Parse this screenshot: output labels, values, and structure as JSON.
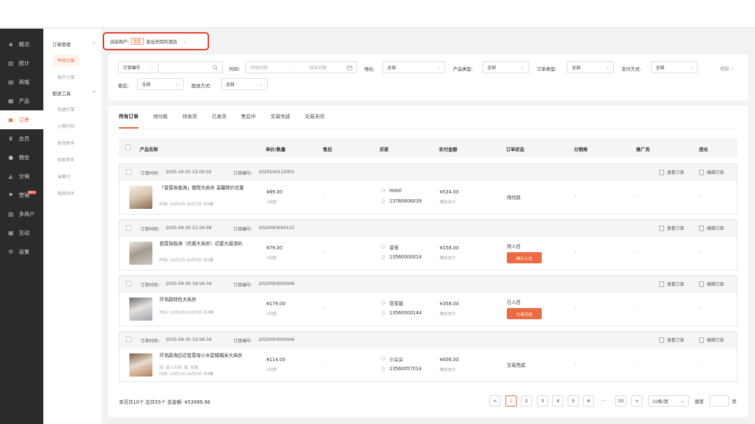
{
  "nav1": [
    {
      "label": "概况",
      "icon": "layers-icon",
      "glyph": "◈"
    },
    {
      "label": "统计",
      "icon": "chart-icon",
      "glyph": "▥"
    },
    {
      "label": "商城",
      "icon": "store-icon",
      "glyph": "▤"
    },
    {
      "label": "产品",
      "icon": "grid-icon",
      "glyph": "▦"
    },
    {
      "label": "订单",
      "icon": "order-icon",
      "glyph": "▣",
      "active": true
    },
    {
      "label": "会员",
      "icon": "crown-icon",
      "glyph": "♛"
    },
    {
      "label": "微信",
      "icon": "wechat-icon",
      "glyph": "●"
    },
    {
      "label": "分销",
      "icon": "distribution-icon",
      "glyph": "◭"
    },
    {
      "label": "营销",
      "icon": "flag-icon",
      "glyph": "⚑",
      "badge": "NEW"
    },
    {
      "label": "多商户",
      "icon": "merchants-icon",
      "glyph": "▧"
    },
    {
      "label": "互动",
      "icon": "interact-icon",
      "glyph": "▦"
    },
    {
      "label": "设置",
      "icon": "gear-icon",
      "glyph": "⚙"
    }
  ],
  "nav2": {
    "group1": "订单管理",
    "group1_items": [
      "平台订单",
      "商户订单"
    ],
    "group2": "配送工具",
    "group2_items": [
      "快递打单",
      "小票打印",
      "发货助手",
      "商家助手",
      "当面付",
      "电商ERP"
    ]
  },
  "merchant": {
    "label": "当前商户:",
    "tag": "直营",
    "name": "浪出天际的酒店"
  },
  "filters": {
    "order_no_select": "订单编号",
    "time_label": "时间:",
    "start_date": "开始日期",
    "date_sep": "-",
    "end_date": "结束日期",
    "address_label": "地址:",
    "address_value": "全部",
    "product_type_label": "产品类型:",
    "product_type_value": "全部",
    "order_type_label": "订单类型:",
    "order_type_value": "全部",
    "pay_method_label": "支付方式:",
    "pay_method_value": "全部",
    "collapse": "收起",
    "aftersale_label": "售后:",
    "aftersale_value": "全部",
    "delivery_label": "配送方式:",
    "delivery_value": "全部"
  },
  "tabs": [
    "所有订单",
    "待付款",
    "待发货",
    "已发货",
    "售后中",
    "交易完成",
    "交易关闭"
  ],
  "table_headers": [
    "产品名称",
    "单价/数量",
    "售后",
    "买家",
    "实付金额",
    "订单状态",
    "分销商",
    "推广员",
    "团长"
  ],
  "orders": [
    {
      "time_label": "订单时间:",
      "time": "2020-10-01  12:00:02",
      "no_label": "订单编号:",
      "no": "2020100112001",
      "view": "查看订单",
      "edit": "编辑订单",
      "name": "「曾厝垵临海」南院大床房 温馨特价优惠",
      "meta1": "时间: 10月1日-10月7日  共6晚",
      "meta2": "",
      "price": "¥89.00",
      "qty": "1间房",
      "aftersale": "-",
      "buyer": "Hotel",
      "phone": "13760606039",
      "amount": "¥534.00",
      "pay": "微信支付",
      "status": "待付款",
      "action": "",
      "distributor": "-",
      "promoter": "-",
      "leader": "-"
    },
    {
      "time_label": "订单时间:",
      "time": "2020-09-30  21:26:58",
      "no_label": "订单编号:",
      "no": "2020093000122",
      "view": "查看订单",
      "edit": "编辑订单",
      "name": "曾厝垵临海（优雅大床房）近厦大鼓浪屿",
      "meta1": "时间: 10月1日-10月3日  共2晚",
      "meta2": "",
      "price": "¥79.00",
      "qty": "1间房",
      "aftersale": "-",
      "buyer": "梁哥",
      "phone": "13560000014",
      "amount": "¥158.00",
      "pay": "微信支付",
      "status": "待入住",
      "action": "确认入住",
      "distributor": "-",
      "promoter": "-",
      "leader": "-"
    },
    {
      "time_label": "订单时间:",
      "time": "2020-09-30  16:56:34",
      "no_label": "订单编号:",
      "no": "2020093000046",
      "view": "查看订单",
      "edit": "编辑订单",
      "name": "环岛路特色大床房",
      "meta1": "时间: 10月1日-10月3日  共2晚",
      "meta2": "",
      "price": "¥179.00",
      "qty": "1间房",
      "aftersale": "-",
      "buyer": "菲菲姐",
      "phone": "13560000144",
      "amount": "¥358.00",
      "pay": "微信支付",
      "status": "已入住",
      "action": "交易完成",
      "distributor": "-",
      "promoter": "-",
      "leader": "-"
    },
    {
      "time_label": "订单时间:",
      "time": "2020-09-30  10:56:34",
      "no_label": "订单编号:",
      "no": "2020093000046",
      "view": "查看订单",
      "edit": "编辑订单",
      "name": "环岛路海边近曾厝垵小木屋榻榻米大床房",
      "meta1": "床: 双人大床; 窗: 有窗",
      "meta2": "时间: 10月1日-10月5日  共4晚",
      "price": "¥114.00",
      "qty": "1间房",
      "aftersale": "-",
      "buyer": "小尖尖",
      "phone": "13560057014",
      "amount": "¥456.00",
      "pay": "微信支付",
      "status": "交易完成",
      "action": "",
      "distributor": "-",
      "promoter": "-",
      "leader": "-"
    }
  ],
  "footer": {
    "summary": "本页共10个  总共55个  总金额: ¥53999.96"
  },
  "pager": {
    "prev": "<",
    "pages": [
      "1",
      "2",
      "3",
      "4",
      "5",
      "6"
    ],
    "ellipsis": "···",
    "last": "10",
    "next": ">",
    "per_page": "10条/页",
    "jump_label": "跳至",
    "page_unit": "页"
  }
}
